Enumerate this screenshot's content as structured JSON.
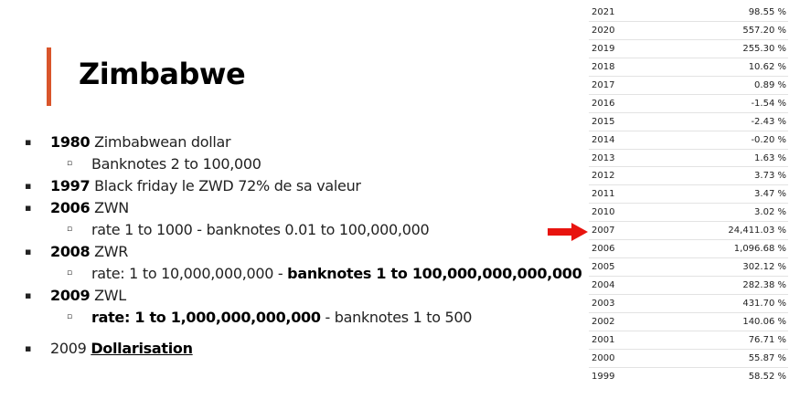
{
  "slide": {
    "title": "Zimbabwe",
    "accent_color": "#d9552b"
  },
  "bullets": [
    {
      "level": 1,
      "parts": [
        {
          "text": "1980",
          "style": "bold"
        },
        {
          "text": " Zimbabwean dollar",
          "style": "normal"
        }
      ]
    },
    {
      "level": 2,
      "parts": [
        {
          "text": "Banknotes 2 to 100,000",
          "style": "normal"
        }
      ]
    },
    {
      "level": 1,
      "parts": [
        {
          "text": "1997",
          "style": "bold"
        },
        {
          "text": " Black friday le ZWD 72% de sa valeur",
          "style": "normal"
        }
      ]
    },
    {
      "level": 1,
      "parts": [
        {
          "text": "2006",
          "style": "bold"
        },
        {
          "text": " ZWN",
          "style": "normal"
        }
      ]
    },
    {
      "level": 2,
      "parts": [
        {
          "text": "rate 1 to 1000 - banknotes 0.01 to 100,000,000",
          "style": "normal"
        }
      ]
    },
    {
      "level": 1,
      "parts": [
        {
          "text": "2008",
          "style": "bold"
        },
        {
          "text": " ZWR",
          "style": "normal"
        }
      ]
    },
    {
      "level": 2,
      "parts": [
        {
          "text": "rate: 1 to 10,000,000,000 - ",
          "style": "normal"
        },
        {
          "text": "banknotes 1 to 100,000,000,000,000",
          "style": "bold"
        }
      ]
    },
    {
      "level": 1,
      "parts": [
        {
          "text": "2009",
          "style": "bold"
        },
        {
          "text": " ZWL",
          "style": "normal"
        }
      ]
    },
    {
      "level": 2,
      "parts": [
        {
          "text": "rate: 1 to 1,000,000,000,000",
          "style": "bold"
        },
        {
          "text": " - banknotes 1 to 500",
          "style": "normal"
        }
      ]
    },
    {
      "level": 1,
      "parts": [
        {
          "text": "2009 ",
          "style": "normal"
        },
        {
          "text": "Dollarisation",
          "style": "underline"
        }
      ]
    }
  ],
  "bullet_markers": {
    "level1": "▪",
    "level2": "▫"
  },
  "inflation_table": [
    {
      "year": "2021",
      "value": "98.55 %"
    },
    {
      "year": "2020",
      "value": "557.20 %"
    },
    {
      "year": "2019",
      "value": "255.30 %"
    },
    {
      "year": "2018",
      "value": "10.62 %"
    },
    {
      "year": "2017",
      "value": "0.89 %"
    },
    {
      "year": "2016",
      "value": "-1.54 %"
    },
    {
      "year": "2015",
      "value": "-2.43 %"
    },
    {
      "year": "2014",
      "value": "-0.20 %"
    },
    {
      "year": "2013",
      "value": "1.63 %"
    },
    {
      "year": "2012",
      "value": "3.73 %"
    },
    {
      "year": "2011",
      "value": "3.47 %"
    },
    {
      "year": "2010",
      "value": "3.02 %"
    },
    {
      "year": "2007",
      "value": "24,411.03 %"
    },
    {
      "year": "2006",
      "value": "1,096.68 %"
    },
    {
      "year": "2005",
      "value": "302.12 %"
    },
    {
      "year": "2004",
      "value": "282.38 %"
    },
    {
      "year": "2003",
      "value": "431.70 %"
    },
    {
      "year": "2002",
      "value": "140.06 %"
    },
    {
      "year": "2001",
      "value": "76.71 %"
    },
    {
      "year": "2000",
      "value": "55.87 %"
    },
    {
      "year": "1999",
      "value": "58.52 %"
    }
  ],
  "highlight": {
    "icon": "red-arrow-right-icon",
    "color": "#e8140f",
    "points_to_year": "2007"
  }
}
